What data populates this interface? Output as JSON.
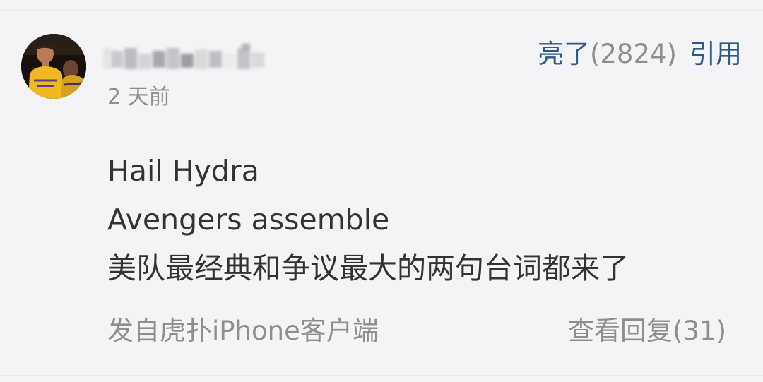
{
  "comment": {
    "timestamp": "2 天前",
    "light_label": "亮了",
    "light_count": "(2824)",
    "quote_label": "引用",
    "lines": [
      "Hail Hydra",
      "Avengers assemble",
      "美队最经典和争议最大的两句台词都来了"
    ],
    "source": "发自虎扑iPhone客户端",
    "view_replies": "查看回复(31)",
    "colors": {
      "accent": "#2f5a86",
      "muted": "#8e8e92",
      "text": "#333336",
      "background": "#f4f4f6"
    }
  }
}
